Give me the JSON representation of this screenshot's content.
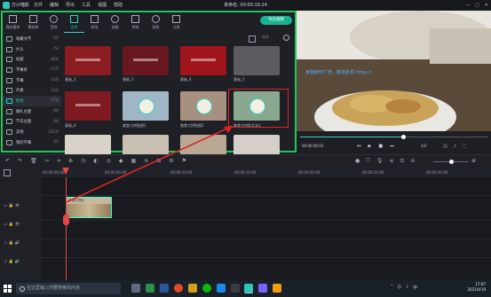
{
  "app": {
    "name": "万兴喵影",
    "title": "未命名: 00:00:10:24",
    "menu": [
      "文件",
      "编辑",
      "导出",
      "工具",
      "视图",
      "帮助"
    ],
    "window_controls": [
      "—",
      "□",
      "✕"
    ]
  },
  "tabs": [
    {
      "label": "我的素材"
    },
    {
      "label": "素材库"
    },
    {
      "label": "音频"
    },
    {
      "label": "文字",
      "active": true
    },
    {
      "label": "转场"
    },
    {
      "label": "滤镜"
    },
    {
      "label": "特效"
    },
    {
      "label": "贴纸"
    },
    {
      "label": "分屏"
    }
  ],
  "export_label": "导出视频",
  "sidebar": [
    {
      "label": "收藏文字",
      "count": "(0)"
    },
    {
      "label": "片头",
      "count": "(5)"
    },
    {
      "label": "标题",
      "count": "(83)"
    },
    {
      "label": "字幕条",
      "count": "(17)"
    },
    {
      "label": "字幕",
      "count": "(14)"
    },
    {
      "label": "片尾",
      "count": "(14)"
    },
    {
      "label": "综合",
      "count": "(73)",
      "active": true
    },
    {
      "label": "婚礼主题",
      "count": "(8)"
    },
    {
      "label": "节日主题",
      "count": "(9)"
    },
    {
      "label": "其他",
      "count": "(253)"
    },
    {
      "label": "我的字幕",
      "count": "(0)"
    }
  ],
  "search_placeholder": "搜索",
  "thumbs": [
    {
      "label": "基础_2",
      "bg": "#8a1c22"
    },
    {
      "label": "基础_3",
      "bg": "#6a1820"
    },
    {
      "label": "基础_4",
      "bg": "#a0141c"
    },
    {
      "label": "基础_5",
      "bg": "#5a5c60"
    },
    {
      "label": "基础_6",
      "bg": "#7e1a20"
    },
    {
      "label": "美食大拼贴图1",
      "bg": "#9fb7c4"
    },
    {
      "label": "美食大拼贴图2",
      "bg": "#a89080"
    },
    {
      "label": "美食大拼贴文本1",
      "bg": "#8aa890"
    },
    {
      "label": "",
      "bg": "#d8d2c8"
    },
    {
      "label": "",
      "bg": "#c9c0b3"
    },
    {
      "label": "",
      "bg": "#b9a994"
    },
    {
      "label": "",
      "bg": "#d4cfc8"
    }
  ],
  "preview": {
    "overlay_text": "食物制作广告，精选素材 https://",
    "timecode": "00:00:00:03",
    "page": "1/2",
    "playhead": "0.55"
  },
  "ruler": [
    "00:00:00:00",
    "00:00:05:00",
    "00:00:10:00",
    "00:00:15:00",
    "00:00:20:00",
    "00:00:25:00",
    "00:00:30:00"
  ],
  "clip": {
    "label": "美食大拼贴"
  },
  "taskbar": {
    "search_placeholder": "在这里输入你要搜索的内容",
    "time": "17:07",
    "date": "2021/4/19"
  },
  "colors": {
    "accent": "#3ad1c4",
    "highlight": "#22c55e",
    "arrow": "#e02424",
    "export": "#19b394"
  }
}
